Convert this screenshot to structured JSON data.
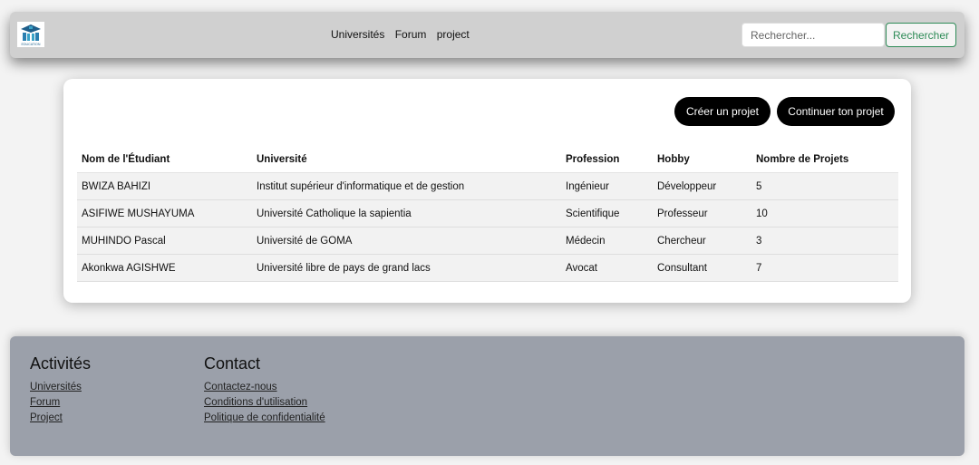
{
  "navbar": {
    "logo_text": "EDUCATION",
    "links": [
      "Universités",
      "Forum",
      "project"
    ],
    "search_placeholder": "Rechercher...",
    "search_button": "Rechercher"
  },
  "actions": {
    "create": "Créer un projet",
    "continue": "Continuer ton projet"
  },
  "table": {
    "headers": [
      "Nom de l'Étudiant",
      "Université",
      "Profession",
      "Hobby",
      "Nombre de Projets"
    ],
    "rows": [
      [
        "BWIZA BAHIZI",
        "Institut supérieur d'informatique et de gestion",
        "Ingénieur",
        "Développeur",
        "5"
      ],
      [
        "ASIFIWE MUSHAYUMA",
        "Université Catholique la sapientia",
        "Scientifique",
        "Professeur",
        "10"
      ],
      [
        "MUHINDO Pascal",
        "Université de GOMA",
        "Médecin",
        "Chercheur",
        "3"
      ],
      [
        "Akonkwa AGISHWE",
        "Université libre de pays de grand lacs",
        "Avocat",
        "Consultant",
        "7"
      ]
    ]
  },
  "footer": {
    "activities": {
      "title": "Activités",
      "links": [
        "Universités",
        "Forum",
        "Project"
      ]
    },
    "contact": {
      "title": "Contact",
      "links": [
        "Contactez-nous",
        "Conditions d'utilisation",
        "Politique de confidentialité"
      ]
    }
  }
}
